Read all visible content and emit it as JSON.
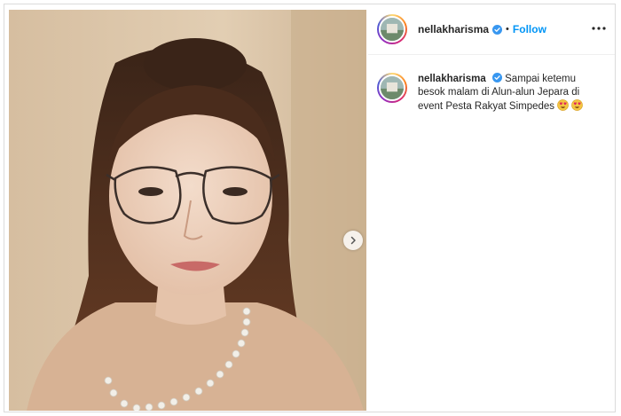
{
  "post": {
    "username": "nellakharisma",
    "separator": "•",
    "follow_label": "Follow",
    "caption": "Sampai ketemu besok malam di Alun-alun Jepara di event Pesta Rakyat Simpedes",
    "caption_emoji": [
      "heart-eyes-emoji",
      "heart-eyes-emoji"
    ]
  },
  "icons": {
    "verified": "verified-badge-icon",
    "more": "more-options-icon",
    "next": "chevron-right-icon"
  },
  "colors": {
    "link_blue": "#0095f6",
    "verified_blue": "#3897f0",
    "text": "#262626",
    "border": "#dbdbdb"
  }
}
